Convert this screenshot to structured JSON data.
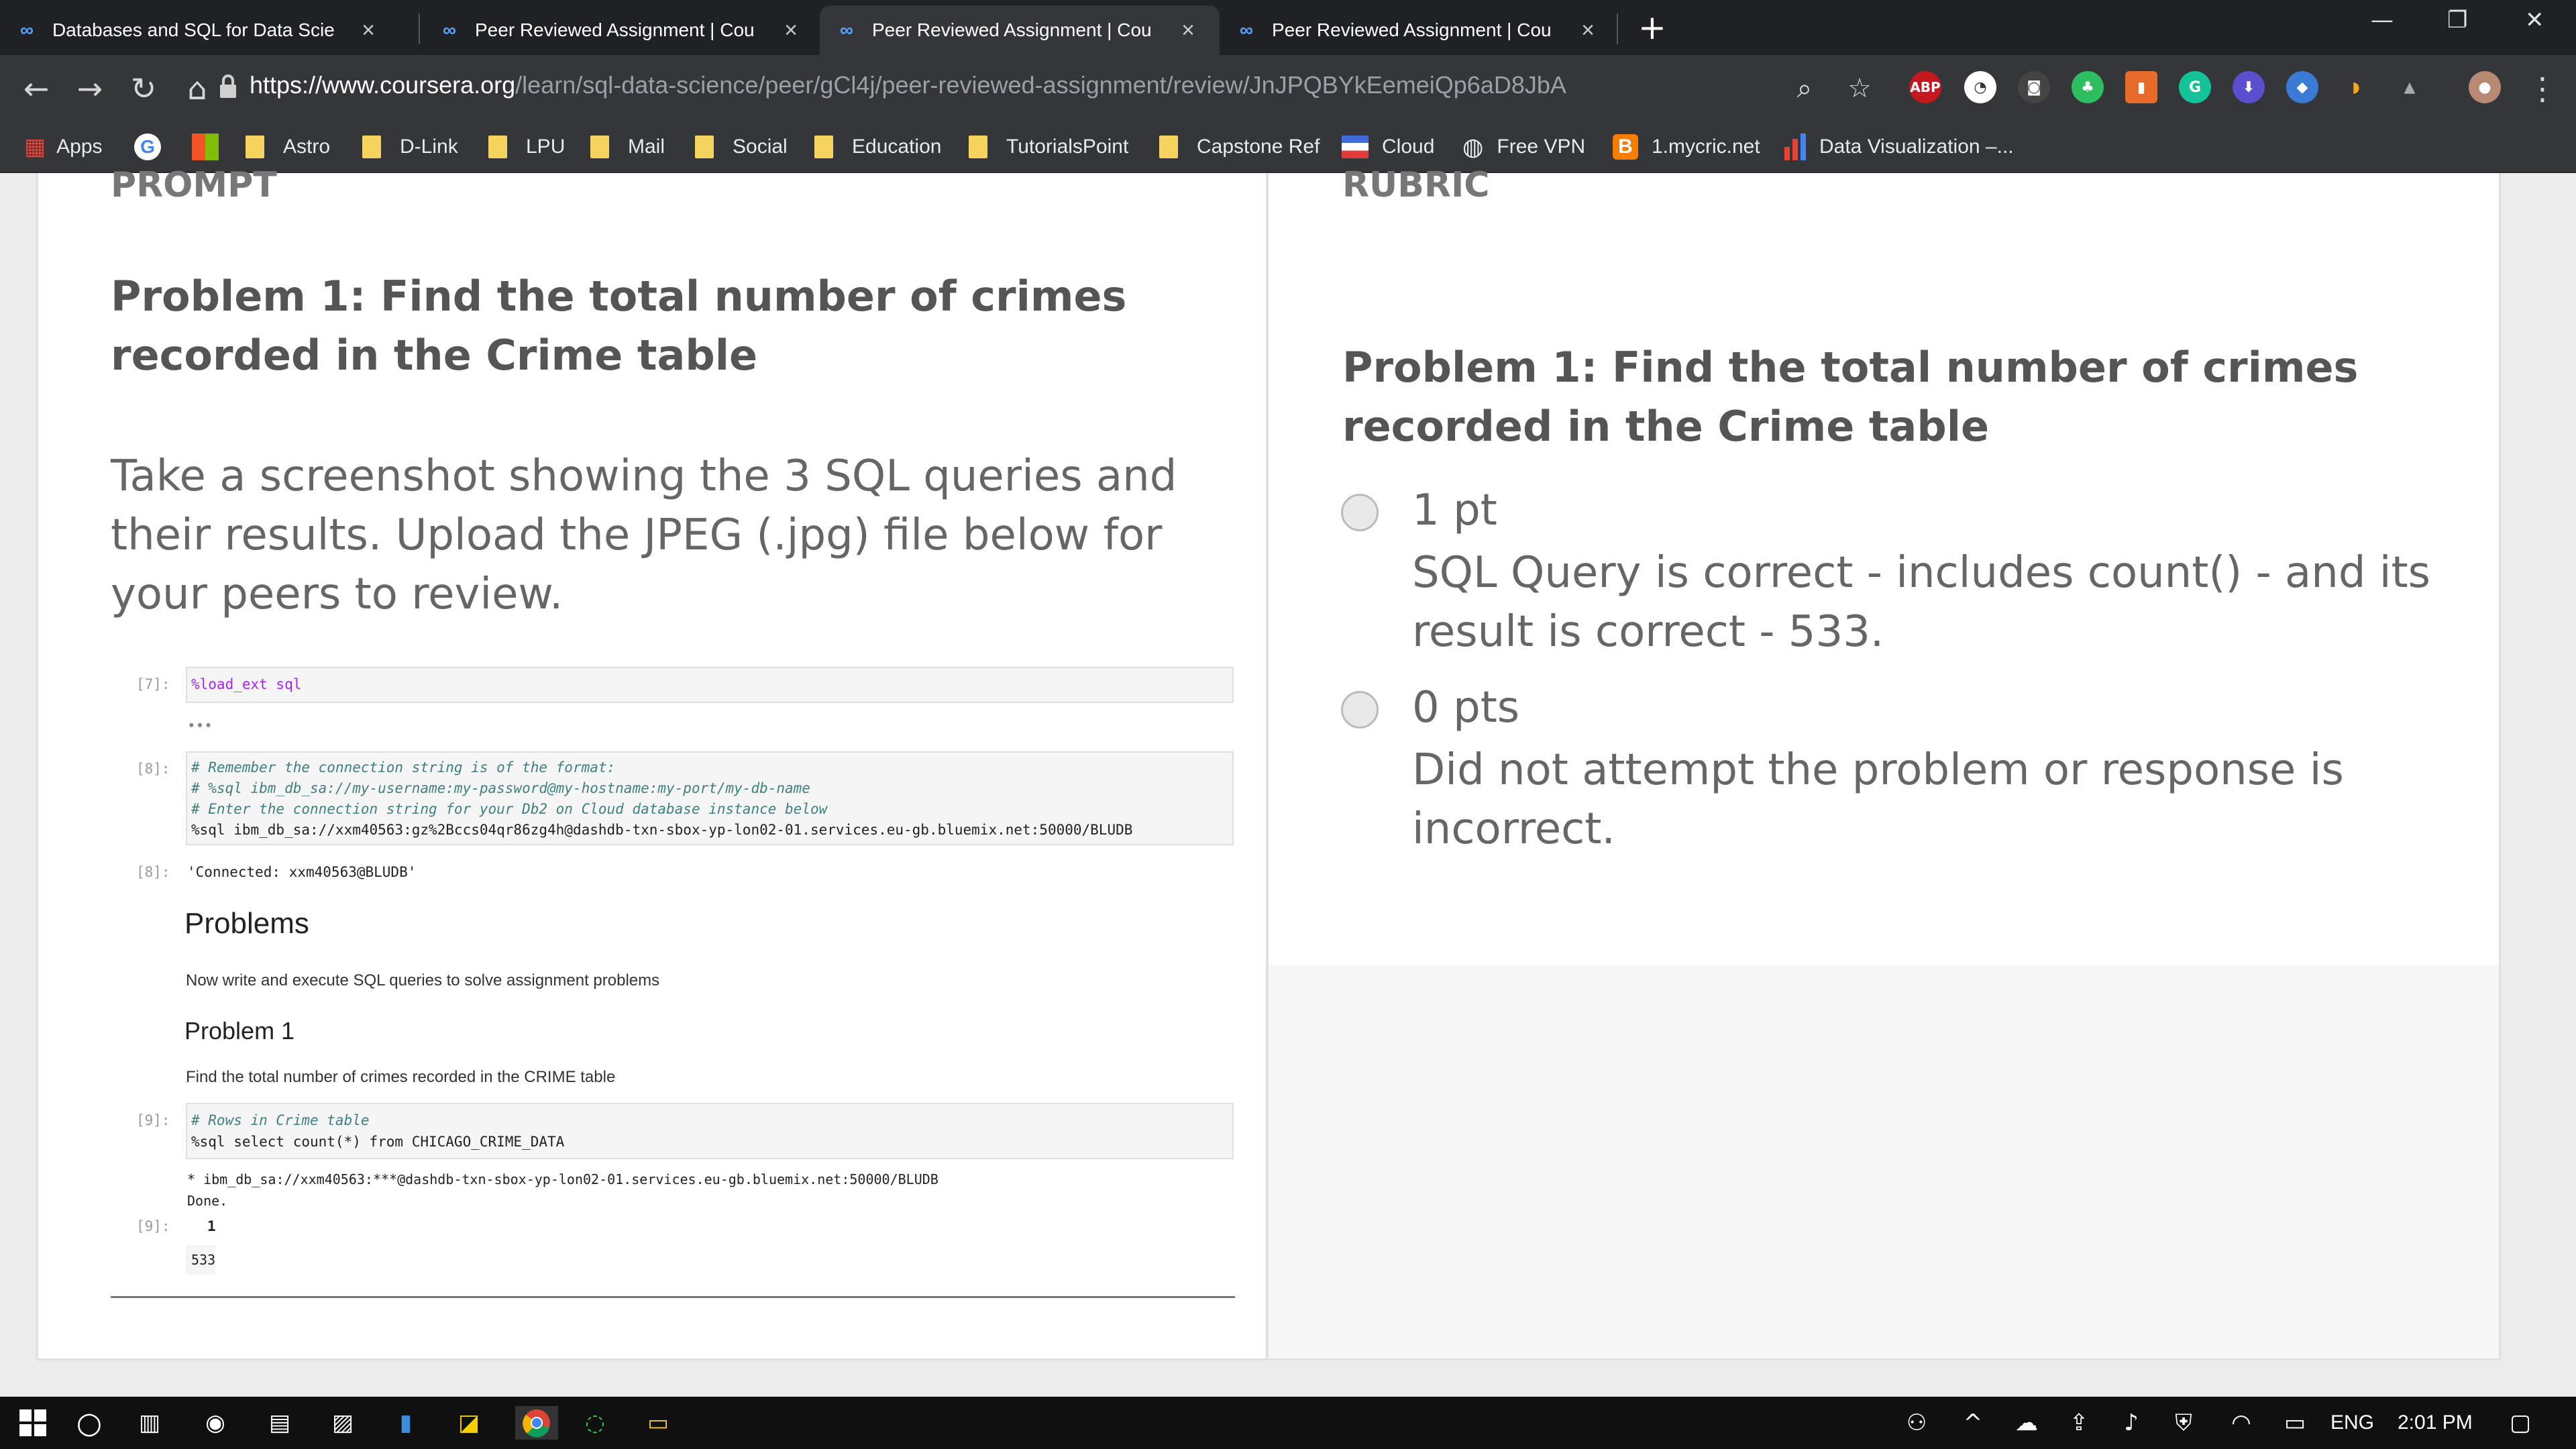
{
  "browser": {
    "tabs": [
      {
        "title": "Databases and SQL for Data Scie",
        "active": false
      },
      {
        "title": "Peer Reviewed Assignment | Cou",
        "active": false
      },
      {
        "title": "Peer Reviewed Assignment | Cou",
        "active": true
      },
      {
        "title": "Peer Reviewed Assignment | Cou",
        "active": false
      }
    ],
    "url_host": "https://www.coursera.org",
    "url_path": "/learn/sql-data-science/peer/gCl4j/peer-reviewed-assignment/review/JnJPQBYkEemeiQp6aD8JbA",
    "extensions": [
      "ABP"
    ],
    "bookmarks": [
      "Apps",
      "Astro",
      "D-Link",
      "LPU",
      "Mail",
      "Social",
      "Education",
      "TutorialsPoint",
      "Capstone Ref",
      "Cloud",
      "Free VPN",
      "1.mycric.net",
      "Data Visualization –..."
    ]
  },
  "prompt": {
    "section_label": "PROMPT",
    "title": "Problem 1: Find the total number of crimes recorded in the Crime table",
    "instructions": "Take a screenshot showing the 3 SQL queries and their results. Upload the JPEG (.jpg) file below for your peers to review.",
    "notebook": {
      "cell7_prompt": "[7]:",
      "cell7_code": "%load_ext sql",
      "ellipsis": "•••",
      "cell8_prompt": "[8]:",
      "cell8_lines": [
        "# Remember the connection string is of the format:",
        "# %sql ibm_db_sa://my-username:my-password@my-hostname:my-port/my-db-name",
        "# Enter the connection string for your Db2 on Cloud database instance below",
        "%sql ibm_db_sa://xxm40563:gz%2Bccs04qr86zg4h@dashdb-txn-sbox-yp-lon02-01.services.eu-gb.bluemix.net:50000/BLUDB"
      ],
      "out8_prompt": "[8]:",
      "out8_text": "'Connected: xxm40563@BLUDB'",
      "heading_problems": "Problems",
      "problems_text": "Now write and execute SQL queries to solve assignment problems",
      "heading_problem1": "Problem 1",
      "problem1_text": "Find the total number of crimes recorded in the CRIME table",
      "cell9_prompt": "[9]:",
      "cell9_lines": [
        "# Rows in Crime table",
        "%sql select count(*) from CHICAGO_CRIME_DATA"
      ],
      "out9_conn": " * ibm_db_sa://xxm40563:***@dashdb-txn-sbox-yp-lon02-01.services.eu-gb.bluemix.net:50000/BLUDB",
      "out9_done": "Done.",
      "out9_prompt": "[9]:",
      "out9_header": "1",
      "out9_value": "533"
    }
  },
  "rubric": {
    "section_label": "RUBRIC",
    "title": "Problem 1: Find the total number of crimes recorded in the Crime table",
    "options": [
      {
        "points": "1 pt",
        "description": "SQL Query is correct - includes count() - and its result is correct - 533."
      },
      {
        "points": "0 pts",
        "description": "Did not attempt the problem or response is incorrect."
      }
    ]
  },
  "taskbar": {
    "language": "ENG",
    "time": "2:01 PM"
  }
}
